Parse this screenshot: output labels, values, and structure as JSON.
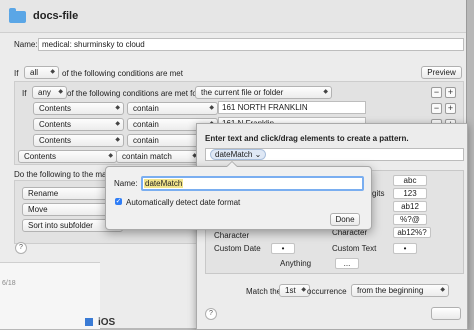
{
  "window": {
    "title": "docs-file"
  },
  "name_row": {
    "label": "Name:",
    "value": "medical: shurminsky to cloud"
  },
  "if_row": {
    "if": "If",
    "quantifier": "all",
    "text": "of the following conditions are met",
    "preview": "Preview"
  },
  "group_row": {
    "if": "If",
    "quantifier": "any",
    "text": "of the following conditions are met for",
    "target": "the current file or folder"
  },
  "conditions": [
    {
      "attribute": "Contents",
      "operator": "contain",
      "value": "161 NORTH FRANKLIN"
    },
    {
      "attribute": "Contents",
      "operator": "contain",
      "value": "161 N Franklin"
    },
    {
      "attribute": "Contents",
      "operator": "contain",
      "value": ""
    },
    {
      "attribute": "Contents",
      "operator": "contain match",
      "value": ""
    }
  ],
  "actions": {
    "label": "Do the following to the mate",
    "items": [
      {
        "label": "Rename"
      },
      {
        "label": "Move"
      },
      {
        "label": "Sort into subfolder"
      }
    ]
  },
  "pattern_sheet": {
    "instruction": "Enter text and click/drag elements to create a pattern.",
    "token": "dateMatch",
    "token_arrows": "⌄",
    "labels": {
      "gits": "gits",
      "character": "Character",
      "custom_date": "Custom Date",
      "custom_text": "Custom Text",
      "anything": "Anything"
    },
    "chips": {
      "abc": "abc",
      "digits": "123",
      "ab12": "ab12",
      "symbols": "%?@",
      "ab12pct": "ab12%?",
      "date_chip": "•",
      "text_chip": "•",
      "anything_chip": "..."
    },
    "match_label": "Match the",
    "match_index": "1st",
    "occurrence_label": "occurrence",
    "occurrence_mode": "from the beginning"
  },
  "date_popover": {
    "name_label": "Name:",
    "name_value": "dateMatch",
    "checkbox_label": "Automatically detect date format",
    "done": "Done"
  },
  "background_strip": {
    "date": "6/18",
    "caption": "iOS"
  },
  "help": "?",
  "colors": {
    "folder": "#5aa6e6",
    "token_bg": "#dfe8f5",
    "focus_ring": "#7aaef0",
    "selection": "#f2e58c",
    "checkbox": "#2f7df6"
  }
}
